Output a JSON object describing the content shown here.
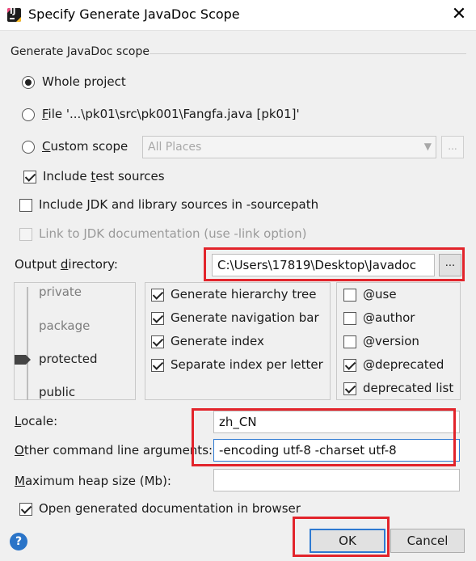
{
  "window": {
    "title": "Specify Generate JavaDoc Scope",
    "close_glyph": "✕"
  },
  "scope": {
    "group_label": "Generate JavaDoc scope",
    "whole_project": "Whole project",
    "file_prefix": "F",
    "file_rest": "ile '...\\pk01\\src\\pk001\\Fangfa.java [pk01]'",
    "custom_prefix": "C",
    "custom_rest": "ustom scope",
    "custom_combo_value": "All Places",
    "combo_arrow": "▼",
    "custom_browse": "...",
    "include_test_a": "Include ",
    "include_test_u": "t",
    "include_test_b": "est sources",
    "include_jdk": "Include JDK and library sources in -sourcepath",
    "link_jdk": "Link to JDK documentation (use -link option)"
  },
  "output": {
    "label_a": "Output ",
    "label_u": "d",
    "label_b": "irectory:",
    "value": "C:\\Users\\17819\\Desktop\\Javadoc",
    "browse": "..."
  },
  "visibility": {
    "levels": [
      "private",
      "package",
      "protected",
      "public"
    ],
    "selected": "protected"
  },
  "generate_options": [
    {
      "label": "Generate hierarchy tree",
      "checked": true
    },
    {
      "label": "Generate navigation bar",
      "checked": true
    },
    {
      "label": "Generate index",
      "checked": true
    },
    {
      "label": "Separate index per letter",
      "checked": true
    }
  ],
  "tag_options": [
    {
      "label": "@use",
      "checked": false
    },
    {
      "label": "@author",
      "checked": false
    },
    {
      "label": "@version",
      "checked": false
    },
    {
      "label": "@deprecated",
      "checked": true
    },
    {
      "label": "deprecated list",
      "checked": true
    }
  ],
  "locale": {
    "label_u": "L",
    "label_b": "ocale:",
    "value": "zh_CN"
  },
  "other_args": {
    "label_u": "O",
    "label_b": "ther command line arguments:",
    "value": "-encoding utf-8 -charset utf-8"
  },
  "heap": {
    "label_u": "M",
    "label_b": "aximum heap size (Mb):",
    "value": ""
  },
  "open_browser": {
    "label": "Open generated documentation in browser",
    "checked": true
  },
  "buttons": {
    "help": "?",
    "ok": "OK",
    "cancel": "Cancel"
  },
  "colors": {
    "highlight_red": "#e2242b",
    "default_button_border": "#2e7ad1",
    "help_blue": "#2a74c8"
  }
}
